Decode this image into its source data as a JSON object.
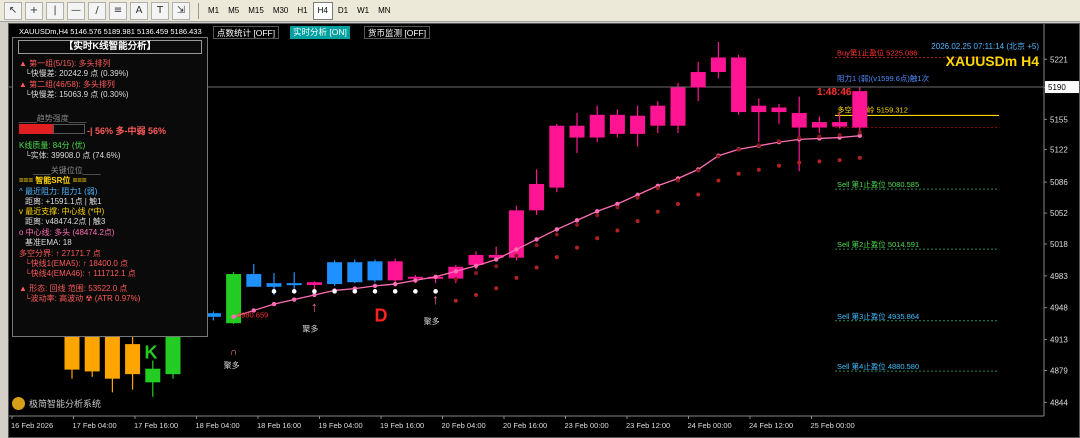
{
  "toolbar": {
    "timeframes": [
      "M1",
      "M5",
      "M15",
      "M30",
      "H1",
      "H4",
      "D1",
      "W1",
      "MN"
    ],
    "active": "H4"
  },
  "symbol": {
    "info": "XAUUSDm,H4  5146.576 5189.981 5136.459 5186.433"
  },
  "buttons": {
    "stats": "点数统计 [OFF]",
    "realtime": "实时分析 [ON]",
    "currency": "货币监测 [OFF]"
  },
  "panel": {
    "title": "【实时K线智能分析】",
    "g1": "▲ 第一组(5/15): 多头排列",
    "g1d": "└快慢差: 20242.9 点 (0.39%)",
    "g2": "▲ 第二组(46/58): 多头排列",
    "g2d": "└快慢差: 15063.9 点 (0.30%)",
    "trend_h": "____趋势强度____",
    "trend_v": "-| 56% 多-中弱 56%",
    "kq": "K线质量: 84分 (优)",
    "kq_d": "└实体: 39908.0 点 (74.6%)",
    "key_h": "____关键位位____",
    "sr_h": "=== 智能SR位 ===",
    "res": "^ 最近阻力: 阻力1 (弱)",
    "res_d": "距离: +1591.1点 | 触1",
    "sup": "v 最近支撑: 中心线 (*中)",
    "sup_d": "距离: v48474.2点 | 触3",
    "mid": "o 中心线: 多头 (48474.2点)",
    "ema": "基准EMA: 18",
    "div": "多空分界: ↑ 27171.7 点",
    "fast": "└快线1(EMA5): ↑ 18400.0 点",
    "slow": "└快线4(EMA46): ↑ 111712.1 点",
    "pat": "▲ 形态: 回线  范围: 53522.0 点",
    "vol": "└波动率: 高波动 ☢ (ATR 0.97%)"
  },
  "footer": "极简智能分析系统",
  "title": {
    "datetime": "2026.02.25 07:11:14 (北京 +5)",
    "symbol": "XAUUSDm H4"
  },
  "countdown": "1:48:46",
  "labels": {
    "buy_stop": "Buy第1止盈位 5225.086",
    "res1": "阻力1 (弱)(v1599.6点)触1次",
    "divider": "多空分水岭 5159.312",
    "sell1": "Sell 第1止盈位 5080.585",
    "sell2": "Sell 第2止盈位 5014.591",
    "sell3": "Sell 第3止盈位 4935.864",
    "sell4": "Sell 第4止盈位 4880.580",
    "price_mark": "4980.659",
    "K": "K",
    "D": "D",
    "gather": "聚多"
  },
  "x_labels": [
    "16 Feb 2026",
    "17 Feb 04:00",
    "17 Feb 16:00",
    "18 Feb 04:00",
    "18 Feb 16:00",
    "19 Feb 04:00",
    "19 Feb 16:00",
    "20 Feb 04:00",
    "20 Feb 16:00",
    "23 Feb 00:00",
    "23 Feb 12:00",
    "24 Feb 00:00",
    "24 Feb 12:00",
    "25 Feb 00:00"
  ],
  "y_labels": [
    "5221",
    "5190",
    "5155",
    "5122",
    "5086",
    "5052",
    "5018",
    "4983",
    "4948",
    "4913",
    "4879",
    "4844"
  ],
  "colors": {
    "bull_pink": "#ff1493",
    "bear_blue": "#1e90ff",
    "orange": "#ffa500",
    "green": "#22cc22",
    "ma": "#ff6eb4",
    "dots": "#b22222"
  },
  "chart_data": {
    "type": "candlestick",
    "symbol": "XAUUSDm",
    "timeframe": "H4",
    "ylim": [
      4829,
      5240
    ],
    "candles": [
      {
        "o": 4922,
        "h": 4930,
        "l": 4870,
        "c": 4880,
        "col": "orange"
      },
      {
        "o": 4921,
        "h": 4935,
        "l": 4872,
        "c": 4878,
        "col": "orange"
      },
      {
        "o": 4923,
        "h": 4938,
        "l": 4855,
        "c": 4870,
        "col": "orange"
      },
      {
        "o": 4908,
        "h": 4935,
        "l": 4858,
        "c": 4875,
        "col": "orange"
      },
      {
        "o": 4866,
        "h": 4890,
        "l": 4850,
        "c": 4881,
        "col": "green"
      },
      {
        "o": 4875,
        "h": 4935,
        "l": 4870,
        "c": 4931,
        "col": "green"
      },
      {
        "o": 4929,
        "h": 4945,
        "l": 4926,
        "c": 4942,
        "col": "green"
      },
      {
        "o": 4938,
        "h": 4944,
        "l": 4934,
        "c": 4942,
        "col": "blue"
      },
      {
        "o": 4931,
        "h": 4987,
        "l": 4930,
        "c": 4985,
        "col": "green"
      },
      {
        "o": 4985,
        "h": 4996,
        "l": 4977,
        "c": 4971,
        "col": "blue"
      },
      {
        "o": 4971,
        "h": 4986,
        "l": 4962,
        "c": 4975,
        "col": "blue"
      },
      {
        "o": 4975,
        "h": 4987,
        "l": 4965,
        "c": 4973,
        "col": "blue"
      },
      {
        "o": 4973,
        "h": 4977,
        "l": 4967,
        "c": 4976,
        "col": "pink"
      },
      {
        "o": 4998,
        "h": 5000,
        "l": 4972,
        "c": 4974,
        "col": "blue"
      },
      {
        "o": 4998,
        "h": 5001,
        "l": 4975,
        "c": 4976,
        "col": "blue"
      },
      {
        "o": 4999,
        "h": 5001,
        "l": 4976,
        "c": 4978,
        "col": "blue"
      },
      {
        "o": 4978,
        "h": 5002,
        "l": 4975,
        "c": 4999,
        "col": "pink"
      },
      {
        "o": 4980,
        "h": 4984,
        "l": 4975,
        "c": 4982,
        "col": "pink"
      },
      {
        "o": 4980,
        "h": 4984,
        "l": 4975,
        "c": 4982,
        "col": "pink"
      },
      {
        "o": 4980,
        "h": 4995,
        "l": 4975,
        "c": 4993,
        "col": "pink"
      },
      {
        "o": 4995,
        "h": 5010,
        "l": 4990,
        "c": 5006,
        "col": "pink"
      },
      {
        "o": 5006,
        "h": 5015,
        "l": 5000,
        "c": 5003,
        "col": "pink"
      },
      {
        "o": 5003,
        "h": 5060,
        "l": 5000,
        "c": 5055,
        "col": "pink"
      },
      {
        "o": 5055,
        "h": 5100,
        "l": 5050,
        "c": 5084,
        "col": "pink"
      },
      {
        "o": 5080,
        "h": 5150,
        "l": 5075,
        "c": 5148,
        "col": "pink"
      },
      {
        "o": 5148,
        "h": 5162,
        "l": 5118,
        "c": 5135,
        "col": "pink"
      },
      {
        "o": 5135,
        "h": 5170,
        "l": 5130,
        "c": 5160,
        "col": "pink"
      },
      {
        "o": 5160,
        "h": 5166,
        "l": 5135,
        "c": 5139,
        "col": "pink"
      },
      {
        "o": 5139,
        "h": 5170,
        "l": 5125,
        "c": 5159,
        "col": "pink"
      },
      {
        "o": 5148,
        "h": 5175,
        "l": 5140,
        "c": 5170,
        "col": "pink"
      },
      {
        "o": 5148,
        "h": 5195,
        "l": 5140,
        "c": 5190,
        "col": "pink"
      },
      {
        "o": 5190,
        "h": 5218,
        "l": 5175,
        "c": 5207,
        "col": "pink"
      },
      {
        "o": 5207,
        "h": 5240,
        "l": 5200,
        "c": 5223,
        "col": "pink"
      },
      {
        "o": 5223,
        "h": 5226,
        "l": 5160,
        "c": 5163,
        "col": "pink"
      },
      {
        "o": 5170,
        "h": 5178,
        "l": 5130,
        "c": 5163,
        "col": "pink"
      },
      {
        "o": 5163,
        "h": 5172,
        "l": 5150,
        "c": 5168,
        "col": "pink"
      },
      {
        "o": 5162,
        "h": 5180,
        "l": 5098,
        "c": 5146,
        "col": "pink"
      },
      {
        "o": 5146,
        "h": 5158,
        "l": 5140,
        "c": 5152,
        "col": "pink"
      },
      {
        "o": 5152,
        "h": 5162,
        "l": 5145,
        "c": 5147,
        "col": "pink"
      },
      {
        "o": 5146,
        "h": 5190,
        "l": 5136,
        "c": 5186,
        "col": "pink"
      }
    ],
    "ma": [
      4922,
      4921,
      4920,
      4920,
      4922,
      4928,
      4934,
      4936,
      4938,
      4945,
      4952,
      4957,
      4962,
      4967,
      4969,
      4972,
      4974,
      4978,
      4982,
      4988,
      4994,
      5001,
      5012,
      5023,
      5034,
      5044,
      5054,
      5062,
      5072,
      5082,
      5090,
      5100,
      5115,
      5122,
      5126,
      5130,
      5133,
      5134,
      5135,
      5137
    ],
    "levels": {
      "buy1": 5225.086,
      "res1": 5190.5,
      "divider": 5159.312,
      "sell1": 5080.585,
      "sell2": 5014.591,
      "sell3": 4935.864,
      "sell4": 4880.58
    }
  }
}
